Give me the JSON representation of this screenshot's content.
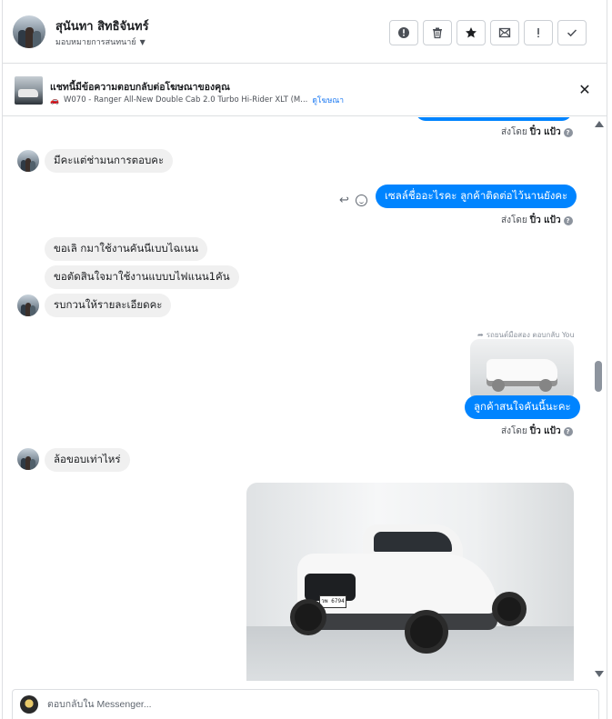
{
  "header": {
    "contact_name": "สุนันทา สิทธิจันทร์",
    "assign_label": "มอบหมายการสนทนาย์",
    "toolbar": [
      {
        "name": "mark-spam-button",
        "icon": "alert-circle-icon"
      },
      {
        "name": "delete-button",
        "icon": "trash-icon"
      },
      {
        "name": "star-button",
        "icon": "star-icon"
      },
      {
        "name": "mark-unread-button",
        "icon": "envelope-icon"
      },
      {
        "name": "follow-up-button",
        "icon": "exclamation-icon"
      },
      {
        "name": "mark-done-button",
        "icon": "check-icon"
      }
    ]
  },
  "ad_banner": {
    "title": "แชทนี้มีข้อความตอบกลับต่อโฆษณาของคุณ",
    "subtitle": "W070 - Ranger All-New Double Cab 2.0 Turbo Hi-Rider XLT (M...",
    "link_label": "ดูโฆษณา",
    "close_icon": "close-icon"
  },
  "thread": {
    "messages": [
      {
        "id": "m0",
        "direction": "out",
        "text": "",
        "sent_by_prefix": "ส่งโดย",
        "sent_by_name": "ปิ๋ว แป้ว"
      },
      {
        "id": "m1",
        "direction": "in",
        "text": "มีคะแต่ช่ามนการตอบคะ"
      },
      {
        "id": "m2",
        "direction": "out",
        "text": "เซลล์ชื่ออะไรคะ  ลูกค้าติดต่อไว้นานยังคะ",
        "sent_by_prefix": "ส่งโดย",
        "sent_by_name": "ปิ๋ว แป้ว"
      },
      {
        "id": "m3",
        "direction": "in",
        "text": "ขอเลิ กมาใช้งานคันนีเบบไฉเนน"
      },
      {
        "id": "m4",
        "direction": "in",
        "text": "ขอตัดสินใจมาใช้งานแบบบไฟแนน1คัน"
      },
      {
        "id": "m5",
        "direction": "in",
        "text": "รบกวนให้รายละเอียดคะ"
      },
      {
        "id": "m6",
        "direction": "out",
        "reply_label": "รถยนต์มือสอง ตอบกลับ You",
        "text": "ลูกค้าสนใจคันนี้นะคะ",
        "sent_by_prefix": "ส่งโดย",
        "sent_by_name": "ปิ๋ว แป้ว"
      },
      {
        "id": "m7",
        "direction": "in",
        "text": "ล้อขอบเท่าไหร่"
      },
      {
        "id": "m8",
        "direction": "out",
        "type": "image",
        "plate_text": "วพ 6794"
      }
    ],
    "info_glyph": "?"
  },
  "composer": {
    "placeholder": "ตอบกลับใน Messenger..."
  },
  "colors": {
    "outgoing_bubble": "#0084ff",
    "incoming_bubble": "#f0f0f0",
    "link": "#1877f2"
  }
}
